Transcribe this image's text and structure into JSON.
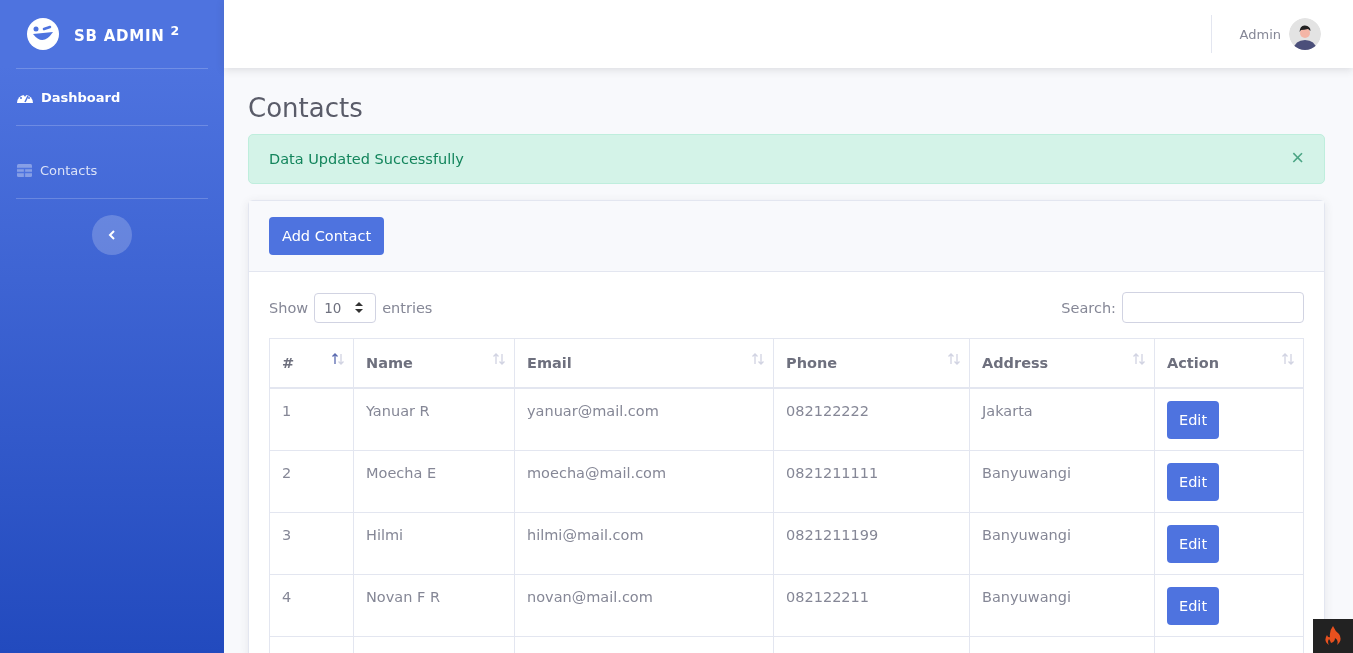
{
  "sidebar": {
    "brand": "SB ADMIN $^{2}$",
    "items": [
      {
        "label": "Dashboard",
        "selected": true
      },
      {
        "label": "Contacts",
        "selected": false
      }
    ]
  },
  "topbar": {
    "user": "Admin"
  },
  "page_title": "Contacts",
  "alert": {
    "message": "Data Updated Successfully",
    "close": "×"
  },
  "card": {
    "button": "Add Contact",
    "length": {
      "before": "Show",
      "value": "10",
      "after": "entries"
    },
    "search": {
      "label": "Search:"
    },
    "table": {
      "columns": [
        {
          "label": "#",
          "sorted": true
        },
        {
          "label": "Name",
          "sorted": false
        },
        {
          "label": "Email",
          "sorted": false
        },
        {
          "label": "Phone",
          "sorted": false
        },
        {
          "label": "Address",
          "sorted": false
        },
        {
          "label": "Action",
          "sorted": false
        }
      ],
      "rows": [
        {
          "cells": [
            "1",
            "Yanuar R",
            "yanuar@mail.com",
            "082122222",
            "Jakarta"
          ],
          "action": "Edit"
        },
        {
          "cells": [
            "2",
            "Moecha E",
            "moecha@mail.com",
            "0821211111",
            "Banyuwangi"
          ],
          "action": "Edit"
        },
        {
          "cells": [
            "3",
            "Hilmi",
            "hilmi@mail.com",
            "0821211199",
            "Banyuwangi"
          ],
          "action": "Edit"
        },
        {
          "cells": [
            "4",
            "Novan F R",
            "novan@mail.com",
            "082122211",
            "Banyuwangi"
          ],
          "action": "Edit"
        }
      ]
    }
  }
}
